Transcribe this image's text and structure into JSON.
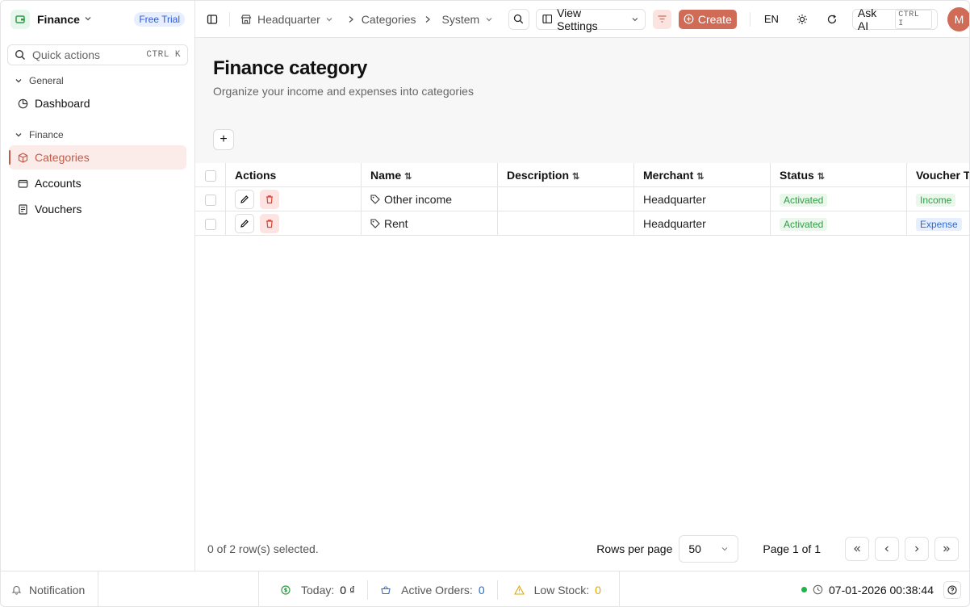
{
  "sidebar": {
    "app_name": "Finance",
    "trial_badge": "Free Trial",
    "quick_actions": {
      "label": "Quick actions",
      "shortcut": "CTRL K"
    },
    "groups": [
      {
        "label": "General",
        "items": [
          {
            "label": "Dashboard",
            "icon": "dashboard-icon"
          }
        ]
      },
      {
        "label": "Finance",
        "items": [
          {
            "label": "Categories",
            "icon": "box-icon",
            "active": true
          },
          {
            "label": "Accounts",
            "icon": "wallet-icon"
          },
          {
            "label": "Vouchers",
            "icon": "document-icon"
          }
        ]
      }
    ]
  },
  "topbar": {
    "breadcrumb": [
      "Headquarter",
      "Categories",
      "System"
    ],
    "view_settings": "View Settings",
    "create": "Create",
    "language": "EN",
    "ask_ai": "Ask AI",
    "ask_ai_shortcut": "CTRL I",
    "avatar": "M"
  },
  "page": {
    "title": "Finance category",
    "subtitle": "Organize your income and expenses into categories",
    "add_button": "+"
  },
  "table": {
    "columns": [
      "Actions",
      "Name",
      "Description",
      "Merchant",
      "Status",
      "Voucher Type"
    ],
    "rows": [
      {
        "name": "Other income",
        "description": "",
        "merchant": "Headquarter",
        "status": "Activated",
        "voucher_type": "Income"
      },
      {
        "name": "Rent",
        "description": "",
        "merchant": "Headquarter",
        "status": "Activated",
        "voucher_type": "Expense"
      }
    ]
  },
  "footer": {
    "selection": "0 of 2 row(s) selected.",
    "rows_per_page_label": "Rows per page",
    "rows_per_page_value": "50",
    "page_info": "Page 1 of 1"
  },
  "statusbar": {
    "notification": "Notification",
    "today_label": "Today:",
    "today_value": "0 ₫",
    "orders_label": "Active Orders:",
    "orders_value": "0",
    "stock_label": "Low Stock:",
    "stock_value": "0",
    "datetime": "07-01-2026 00:38:44"
  },
  "colors": {
    "accent": "#cf6b56",
    "active_bg": "#fbecea",
    "success": "#2f9c45",
    "info": "#2f6ad1"
  }
}
